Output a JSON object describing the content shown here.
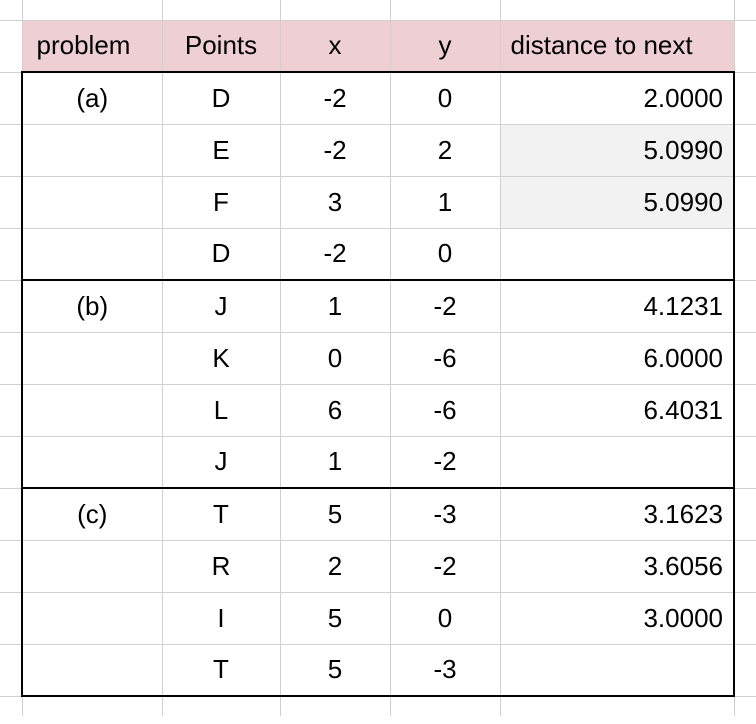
{
  "headers": {
    "problem": "problem",
    "points": "Points",
    "x": "x",
    "y": "y",
    "distance": "distance to next"
  },
  "blocks": [
    {
      "label": "(a)",
      "rows": [
        {
          "point": "D",
          "x": "-2",
          "y": "0",
          "dist": "2.0000"
        },
        {
          "point": "E",
          "x": "-2",
          "y": "2",
          "dist": "5.0990"
        },
        {
          "point": "F",
          "x": "3",
          "y": "1",
          "dist": "5.0990"
        },
        {
          "point": "D",
          "x": "-2",
          "y": "0",
          "dist": ""
        }
      ]
    },
    {
      "label": "(b)",
      "rows": [
        {
          "point": "J",
          "x": "1",
          "y": "-2",
          "dist": "4.1231"
        },
        {
          "point": "K",
          "x": "0",
          "y": "-6",
          "dist": "6.0000"
        },
        {
          "point": "L",
          "x": "6",
          "y": "-6",
          "dist": "6.4031"
        },
        {
          "point": "J",
          "x": "1",
          "y": "-2",
          "dist": ""
        }
      ]
    },
    {
      "label": "(c)",
      "rows": [
        {
          "point": "T",
          "x": "5",
          "y": "-3",
          "dist": "3.1623"
        },
        {
          "point": "R",
          "x": "2",
          "y": "-2",
          "dist": "3.6056"
        },
        {
          "point": "I",
          "x": "5",
          "y": "0",
          "dist": "3.0000"
        },
        {
          "point": "T",
          "x": "5",
          "y": "-3",
          "dist": ""
        }
      ]
    }
  ]
}
